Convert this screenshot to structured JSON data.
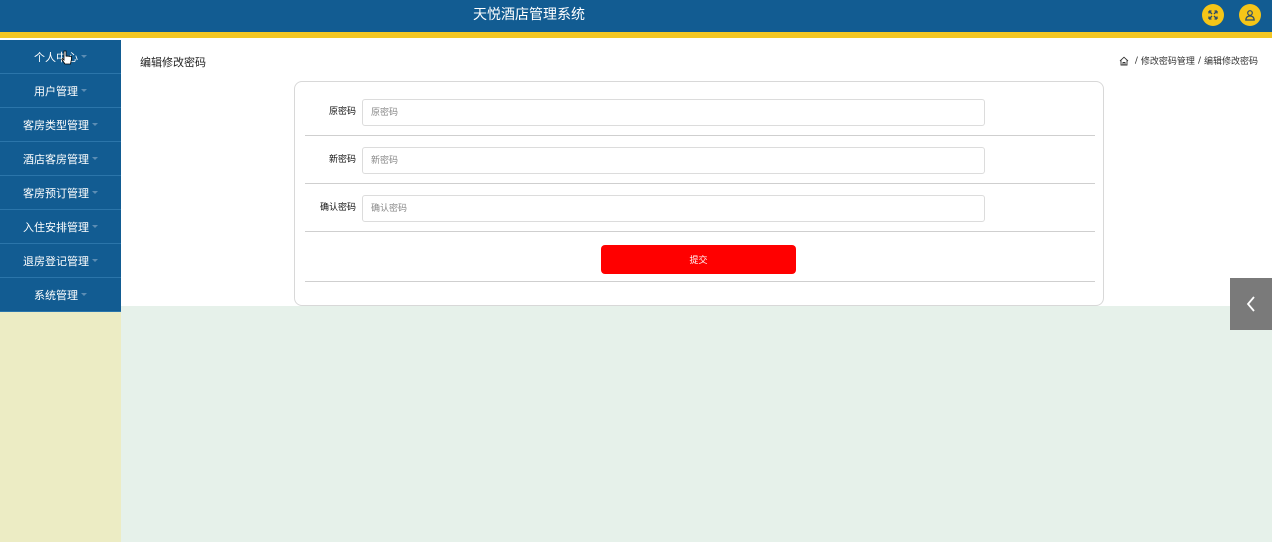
{
  "header": {
    "title": "天悦酒店管理系统",
    "accent_color": "#125c92",
    "stripe_color": "#f3c623",
    "expand_icon": "fullscreen-icon",
    "user_icon": "user-icon"
  },
  "sidebar": {
    "items": [
      {
        "label": "个人中心"
      },
      {
        "label": "用户管理"
      },
      {
        "label": "客房类型管理"
      },
      {
        "label": "酒店客房管理"
      },
      {
        "label": "客房预订管理"
      },
      {
        "label": "入住安排管理"
      },
      {
        "label": "退房登记管理"
      },
      {
        "label": "系统管理"
      }
    ]
  },
  "main": {
    "page_title": "编辑修改密码",
    "breadcrumb": [
      "修改密码管理",
      "编辑修改密码"
    ],
    "breadcrumb_separator": "/"
  },
  "form": {
    "fields": [
      {
        "label": "原密码",
        "placeholder": "原密码",
        "value": ""
      },
      {
        "label": "新密码",
        "placeholder": "新密码",
        "value": ""
      },
      {
        "label": "确认密码",
        "placeholder": "确认密码",
        "value": ""
      }
    ],
    "submit_label": "提交",
    "submit_color": "#ff0000"
  }
}
